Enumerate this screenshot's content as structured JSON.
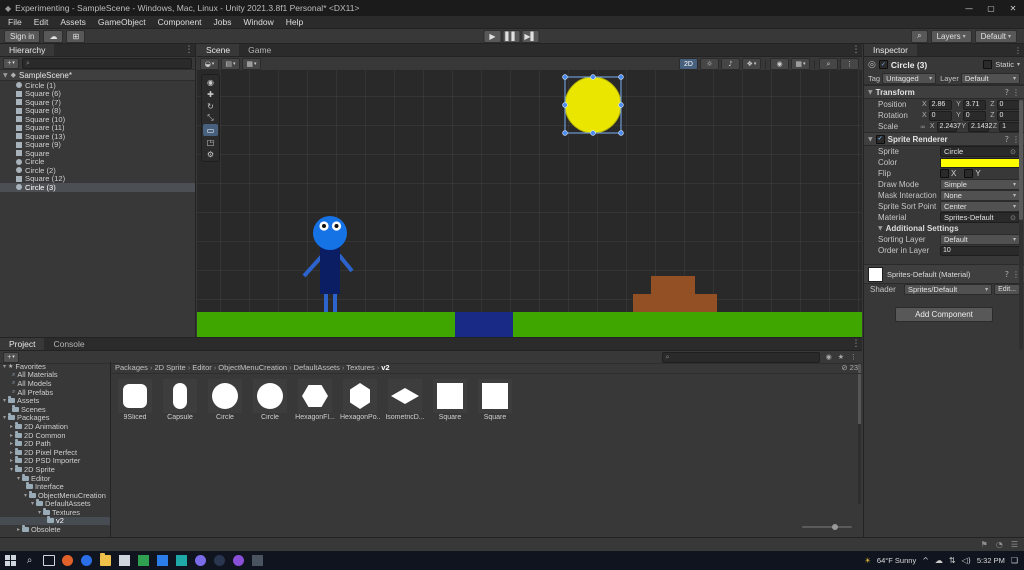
{
  "window": {
    "title": "Experimenting - SampleScene - Windows, Mac, Linux - Unity 2021.3.8f1 Personal* <DX11>"
  },
  "menu_bar": {
    "items": [
      "File",
      "Edit",
      "Assets",
      "GameObject",
      "Component",
      "Jobs",
      "Window",
      "Help"
    ]
  },
  "toolbar": {
    "sign_in_label": "Sign in",
    "layers_label": "Layers",
    "layout_label": "Default"
  },
  "hierarchy": {
    "tab_label": "Hierarchy",
    "scene_name": "SampleScene*",
    "items": [
      {
        "label": "Circle (1)",
        "shape": "circle",
        "selected": false
      },
      {
        "label": "Square (6)",
        "shape": "square",
        "selected": false
      },
      {
        "label": "Square (7)",
        "shape": "square",
        "selected": false
      },
      {
        "label": "Square (8)",
        "shape": "square",
        "selected": false
      },
      {
        "label": "Square (10)",
        "shape": "square",
        "selected": false
      },
      {
        "label": "Square (11)",
        "shape": "square",
        "selected": false
      },
      {
        "label": "Square (13)",
        "shape": "square",
        "selected": false
      },
      {
        "label": "Square (9)",
        "shape": "square",
        "selected": false
      },
      {
        "label": "Square",
        "shape": "square",
        "selected": false
      },
      {
        "label": "Circle",
        "shape": "circle",
        "selected": false
      },
      {
        "label": "Circle (2)",
        "shape": "circle",
        "selected": false
      },
      {
        "label": "Square (12)",
        "shape": "square",
        "selected": false
      },
      {
        "label": "Circle (3)",
        "shape": "circle",
        "selected": true
      }
    ]
  },
  "scene_view": {
    "tabs": [
      {
        "label": "Scene",
        "active": true
      },
      {
        "label": "Game",
        "active": false
      }
    ],
    "toolbar": {
      "mode_2d": "2D"
    },
    "active_tool_index": 4,
    "tools": [
      {
        "name": "view-tool",
        "icon": "view-tool-icon"
      },
      {
        "name": "move-tool",
        "icon": "move-tool-icon"
      },
      {
        "name": "rotate-tool",
        "icon": "rotate-tool-icon"
      },
      {
        "name": "scale-tool",
        "icon": "scale-tool-icon"
      },
      {
        "name": "rect-tool",
        "icon": "rect-tool-icon"
      },
      {
        "name": "transform-tool",
        "icon": "transform-tool-icon"
      },
      {
        "name": "custom-tool",
        "icon": "custom-tool-icon"
      }
    ],
    "colors": {
      "ground": "#3fa600",
      "platform": "#182a85",
      "blocks": "#935025",
      "character_head": "#1673e6",
      "character_body": "#0b1e63",
      "character_limbs": "#2c63cc",
      "eye_white": "#ffffff",
      "pupil": "#101010",
      "sprite_yellow": "#eae600"
    }
  },
  "inspector": {
    "tab_label": "Inspector",
    "header": {
      "name": "Circle (3)",
      "static_label": "Static",
      "tag_label": "Tag",
      "tag_value": "Untagged",
      "layer_label": "Layer",
      "layer_value": "Default"
    },
    "transform": {
      "title": "Transform",
      "axis_labels": [
        "X",
        "Y",
        "Z"
      ],
      "rows": [
        {
          "label": "Position",
          "x": "2.86",
          "y": "3.71",
          "z": "0"
        },
        {
          "label": "Rotation",
          "x": "0",
          "y": "0",
          "z": "0"
        },
        {
          "label": "Scale",
          "x": "2.2437",
          "y": "2.1432",
          "z": "1",
          "linked": true
        }
      ]
    },
    "sprite_renderer": {
      "title": "Sprite Renderer",
      "fields": [
        {
          "label": "Sprite",
          "value": "Circle",
          "type": "object"
        },
        {
          "label": "Color",
          "value": "#FFFF00",
          "type": "color"
        },
        {
          "label": "Flip",
          "type": "flip",
          "x_label": "X",
          "y_label": "Y"
        },
        {
          "label": "Draw Mode",
          "value": "Simple",
          "type": "dropdown"
        },
        {
          "label": "Mask Interaction",
          "value": "None",
          "type": "dropdown"
        },
        {
          "label": "Sprite Sort Point",
          "value": "Center",
          "type": "dropdown"
        },
        {
          "label": "Material",
          "value": "Sprites-Default",
          "type": "object"
        }
      ],
      "additional_settings_label": "Additional Settings",
      "additional": [
        {
          "label": "Sorting Layer",
          "value": "Default",
          "type": "dropdown"
        },
        {
          "label": "Order in Layer",
          "value": "10",
          "type": "input"
        }
      ]
    },
    "material_section": {
      "title": "Sprites-Default (Material)",
      "shader_label": "Shader",
      "shader_value": "Sprites/Default",
      "edit_label": "Edit..."
    },
    "add_component_label": "Add Component"
  },
  "project": {
    "tabs": [
      {
        "label": "Project",
        "active": true
      },
      {
        "label": "Console",
        "active": false
      }
    ],
    "breadcrumb": [
      "Packages",
      "2D Sprite",
      "Editor",
      "ObjectMenuCreation",
      "DefaultAssets",
      "Textures",
      "v2"
    ],
    "breadcrumb_separator": "›",
    "hidden_count": "23",
    "tree": [
      {
        "label": "Favorites",
        "depth": 0,
        "icon": "star",
        "arrow": "down"
      },
      {
        "label": "All Materials",
        "depth": 1,
        "icon": "search"
      },
      {
        "label": "All Models",
        "depth": 1,
        "icon": "search"
      },
      {
        "label": "All Prefabs",
        "depth": 1,
        "icon": "search"
      },
      {
        "label": "Assets",
        "depth": 0,
        "icon": "folder",
        "arrow": "down"
      },
      {
        "label": "Scenes",
        "depth": 1,
        "icon": "folder"
      },
      {
        "label": "Packages",
        "depth": 0,
        "icon": "folder",
        "arrow": "down"
      },
      {
        "label": "2D Animation",
        "depth": 1,
        "icon": "folder",
        "arrow": "right"
      },
      {
        "label": "2D Common",
        "depth": 1,
        "icon": "folder",
        "arrow": "right"
      },
      {
        "label": "2D Path",
        "depth": 1,
        "icon": "folder",
        "arrow": "right"
      },
      {
        "label": "2D Pixel Perfect",
        "depth": 1,
        "icon": "folder",
        "arrow": "right"
      },
      {
        "label": "2D PSD Importer",
        "depth": 1,
        "icon": "folder",
        "arrow": "right"
      },
      {
        "label": "2D Sprite",
        "depth": 1,
        "icon": "folder",
        "arrow": "down"
      },
      {
        "label": "Editor",
        "depth": 2,
        "icon": "folder",
        "arrow": "down"
      },
      {
        "label": "Interface",
        "depth": 3,
        "icon": "folder"
      },
      {
        "label": "ObjectMenuCreation",
        "depth": 3,
        "icon": "folder",
        "arrow": "down"
      },
      {
        "label": "DefaultAssets",
        "depth": 4,
        "icon": "folder",
        "arrow": "down"
      },
      {
        "label": "Textures",
        "depth": 5,
        "icon": "folder",
        "arrow": "down"
      },
      {
        "label": "v2",
        "depth": 6,
        "icon": "folder",
        "selected": true
      },
      {
        "label": "Obsolete",
        "depth": 2,
        "icon": "folder",
        "arrow": "right"
      }
    ],
    "assets": [
      {
        "label": "9Sliced",
        "shape": "rounded"
      },
      {
        "label": "Capsule",
        "shape": "capsule"
      },
      {
        "label": "Circle",
        "shape": "circle"
      },
      {
        "label": "Circle",
        "shape": "circle"
      },
      {
        "label": "HexagonFl...",
        "shape": "hexflat"
      },
      {
        "label": "HexagonPo...",
        "shape": "hexpoint"
      },
      {
        "label": "IsometricD...",
        "shape": "diamond"
      },
      {
        "label": "Square",
        "shape": "square"
      },
      {
        "label": "Square",
        "shape": "square"
      }
    ]
  },
  "taskbar": {
    "apps": [
      {
        "color": "#e2602a",
        "shape": "circle"
      },
      {
        "color": "#2a6fe8",
        "shape": "circle"
      },
      {
        "color": "#f0c04a",
        "shape": "folder"
      },
      {
        "color": "#cfd6dd",
        "shape": "square"
      },
      {
        "color": "#2ea04f",
        "shape": "square"
      },
      {
        "color": "#2b7de9",
        "shape": "square"
      },
      {
        "color": "#1fa8a8",
        "shape": "square"
      },
      {
        "color": "#7a6ce8",
        "shape": "circle"
      },
      {
        "color": "#2a3550",
        "shape": "circle"
      },
      {
        "color": "#8a50d8",
        "shape": "circle"
      },
      {
        "color": "#4a5360",
        "shape": "square"
      }
    ],
    "tray": {
      "weather": "64°F Sunny",
      "time": "5:32 PM"
    }
  },
  "icons": {
    "unity-icon": "◆",
    "minimize-icon": "—",
    "maximize-icon": "▢",
    "close-icon": "✕",
    "cloud-icon": "☁",
    "services-icon": "⊞",
    "search-icon": "⌕",
    "caret-down-icon": "▾",
    "play-icon": "▶",
    "pause-icon": "▌▌",
    "step-icon": "▶▌",
    "kebab-icon": "⋮",
    "plus-icon": "+",
    "star-icon": "★",
    "view-tool-icon": "◉",
    "move-tool-icon": "✚",
    "rotate-tool-icon": "↻",
    "scale-tool-icon": "⤡",
    "rect-tool-icon": "▭",
    "transform-tool-icon": "◳",
    "custom-tool-icon": "⚙",
    "draw-mode-icon": "◒",
    "view-options-icon": "▤",
    "snap-icon": "▦",
    "lighting-icon": "☼",
    "audio-icon": "♪",
    "effects-icon": "❖",
    "hidden-objects-icon": "◉",
    "grid-icon": "▦",
    "object-picker-icon": "⊙",
    "help-icon": "?",
    "link-icon": "∞",
    "hidden-count-icon": "⊘",
    "tray-arrow-icon": "^",
    "weather-icon": "☀",
    "network-icon": "⇅",
    "volume-icon": "◁)",
    "notification-icon": "❏",
    "status-flag-icon": "⚑",
    "status-progress-icon": "◔",
    "status-console-icon": "☰",
    "scene-arrow-icon": "▼"
  }
}
